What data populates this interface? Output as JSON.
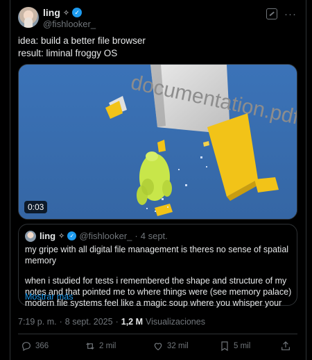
{
  "author": {
    "display_name": "ling",
    "sparkle": "✧",
    "handle": "@fishlooker_"
  },
  "tweet": {
    "line1": "idea: build a better file browser",
    "line2": "result: liminal froggy OS"
  },
  "media": {
    "duration": "0:03",
    "scene_text": "documentation.pdf"
  },
  "quote": {
    "display_name": "ling",
    "sparkle": "✧",
    "handle": "@fishlooker_",
    "separator": "·",
    "date": "4 sept.",
    "para1": "my gripe with all digital file management is theres no sense of spatial memory",
    "para2": "when i studied for tests i remembered the shape and structure of my notes and that pointed me to where things were (see memory palace) modern file systems feel like a magic soup where you whisper your",
    "show_more": "Mostrar más"
  },
  "meta": {
    "time": "7:19 p. m.",
    "separator": "·",
    "date": "8 sept. 2025",
    "views_count": "1,2 M",
    "views_label": "Visualizaciones"
  },
  "actions": {
    "replies": "366",
    "reposts": "2 mil",
    "likes": "32 mil",
    "bookmarks": "5 mil"
  },
  "colors": {
    "background": "#000000",
    "accent": "#1d9bf0",
    "muted": "#71767b",
    "border": "#2f3336",
    "scene_sky": "#3a6fb0",
    "folder_yellow": "#f2c318",
    "frog_green": "#c8e64a"
  }
}
